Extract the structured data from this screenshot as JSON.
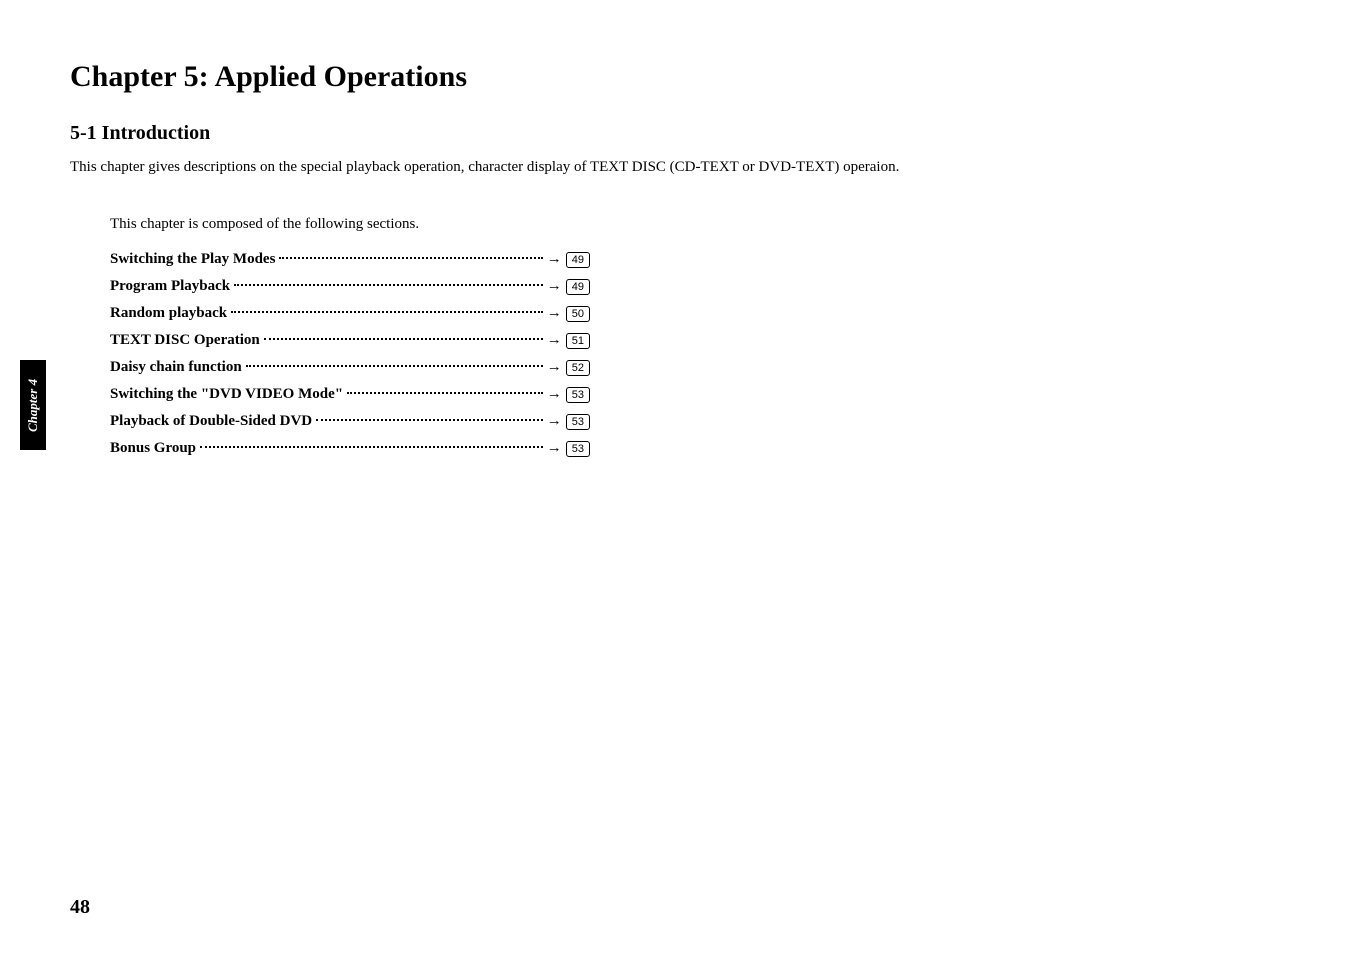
{
  "chapter_title": "Chapter 5: Applied Operations",
  "section_title": "5-1  Introduction",
  "intro_text": "This chapter gives descriptions on the special playback operation, character display of TEXT DISC (CD-TEXT or DVD-TEXT) operaion.",
  "composed_text": "This chapter is composed of the following sections.",
  "toc": [
    {
      "label": "Switching the Play Modes",
      "page": "49"
    },
    {
      "label": "Program Playback",
      "page": "49"
    },
    {
      "label": "Random playback",
      "page": "50"
    },
    {
      "label": "TEXT DISC Operation",
      "page": "51"
    },
    {
      "label": "Daisy chain function",
      "page": "52"
    },
    {
      "label": "Switching the \"DVD VIDEO Mode\"",
      "page": "53"
    },
    {
      "label": "Playback of Double-Sided DVD",
      "page": "53"
    },
    {
      "label": "Bonus Group",
      "page": "53"
    }
  ],
  "side_tab": "Chapter 4",
  "page_number": "48",
  "arrow": "→"
}
